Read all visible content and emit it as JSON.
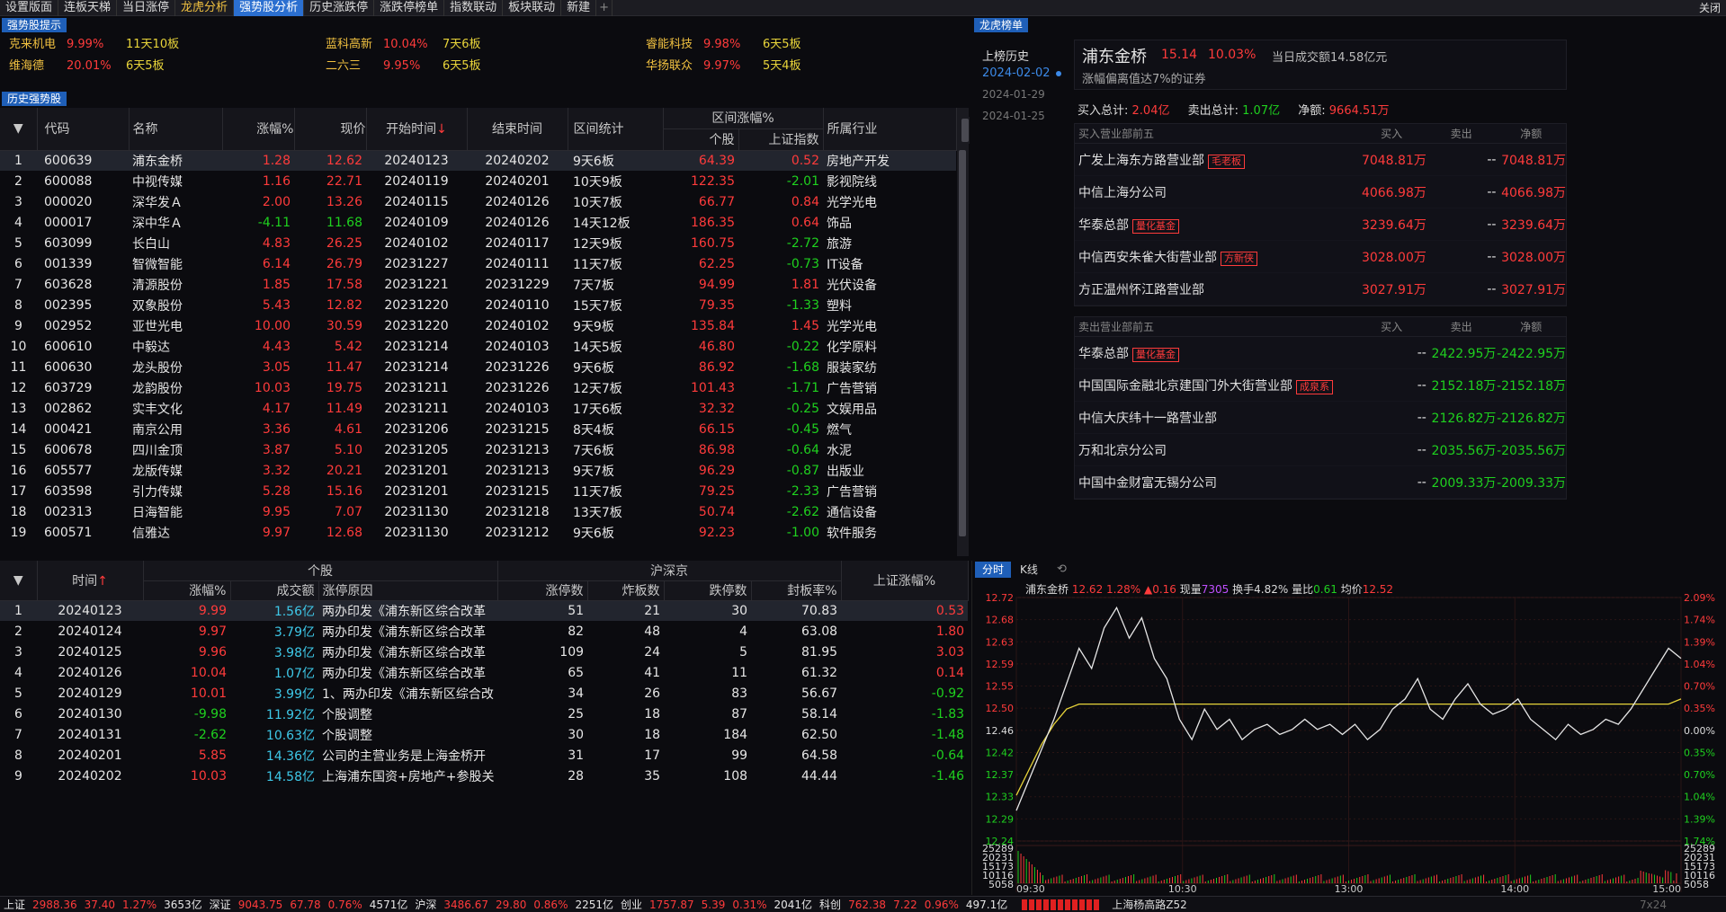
{
  "topbar": {
    "tabs": [
      {
        "label": "设置版面",
        "style": ""
      },
      {
        "label": "连板天梯",
        "style": ""
      },
      {
        "label": "当日涨停",
        "style": ""
      },
      {
        "label": "龙虎分析",
        "style": "hl"
      },
      {
        "label": "强势股分析",
        "style": "active"
      },
      {
        "label": "历史涨跌停",
        "style": ""
      },
      {
        "label": "涨跌停榜单",
        "style": ""
      },
      {
        "label": "指数联动",
        "style": ""
      },
      {
        "label": "板块联动",
        "style": ""
      },
      {
        "label": "新建",
        "style": ""
      }
    ],
    "plus": "+",
    "close": "关闭"
  },
  "hint": {
    "title": "强势股提示",
    "items": [
      {
        "name": "克来机电",
        "pct": "9.99%",
        "board": "11天10板"
      },
      {
        "name": "蓝科高新",
        "pct": "10.04%",
        "board": "7天6板"
      },
      {
        "name": "睿能科技",
        "pct": "9.98%",
        "board": "6天5板"
      },
      {
        "name": "维海德",
        "pct": "20.01%",
        "board": "6天5板"
      },
      {
        "name": "二六三",
        "pct": "9.95%",
        "board": "6天5板"
      },
      {
        "name": "华扬联众",
        "pct": "9.97%",
        "board": "5天4板"
      }
    ]
  },
  "hist": {
    "title": "历史强势股",
    "headers": {
      "code": "代码",
      "name": "名称",
      "pct": "涨幅%",
      "price": "现价",
      "start": "开始时间",
      "end": "结束时间",
      "stat": "区间统计",
      "range": "区间涨幅%",
      "stock": "个股",
      "index": "上证指数",
      "industry": "所属行业",
      "sort_arrow": "↓"
    },
    "rows": [
      [
        "1",
        "600639",
        "浦东金桥",
        "1.28",
        "12.62",
        "20240123",
        "20240202",
        "9天6板",
        "64.39",
        "0.52",
        "房地产开发"
      ],
      [
        "2",
        "600088",
        "中视传媒",
        "1.16",
        "22.71",
        "20240119",
        "20240201",
        "10天9板",
        "122.35",
        "-2.01",
        "影视院线"
      ],
      [
        "3",
        "000020",
        "深华发Ａ",
        "2.00",
        "13.26",
        "20240115",
        "20240126",
        "10天7板",
        "66.77",
        "0.84",
        "光学光电"
      ],
      [
        "4",
        "000017",
        "深中华Ａ",
        "-4.11",
        "11.68",
        "20240109",
        "20240126",
        "14天12板",
        "186.35",
        "0.64",
        "饰品"
      ],
      [
        "5",
        "603099",
        "长白山",
        "4.83",
        "26.25",
        "20240102",
        "20240117",
        "12天9板",
        "160.75",
        "-2.72",
        "旅游"
      ],
      [
        "6",
        "001339",
        "智微智能",
        "6.14",
        "26.79",
        "20231227",
        "20240111",
        "11天7板",
        "62.25",
        "-0.73",
        "IT设备"
      ],
      [
        "7",
        "603628",
        "清源股份",
        "1.85",
        "17.58",
        "20231221",
        "20231229",
        "7天7板",
        "94.99",
        "1.81",
        "光伏设备"
      ],
      [
        "8",
        "002395",
        "双象股份",
        "5.43",
        "12.82",
        "20231220",
        "20240110",
        "15天7板",
        "79.35",
        "-1.33",
        "塑料"
      ],
      [
        "9",
        "002952",
        "亚世光电",
        "10.00",
        "30.59",
        "20231220",
        "20240102",
        "9天9板",
        "135.84",
        "1.45",
        "光学光电"
      ],
      [
        "10",
        "600610",
        "中毅达",
        "4.43",
        "5.42",
        "20231214",
        "20240103",
        "14天5板",
        "46.80",
        "-0.22",
        "化学原料"
      ],
      [
        "11",
        "600630",
        "龙头股份",
        "3.05",
        "11.47",
        "20231214",
        "20231226",
        "9天6板",
        "86.92",
        "-1.68",
        "服装家纺"
      ],
      [
        "12",
        "603729",
        "龙韵股份",
        "10.03",
        "19.75",
        "20231211",
        "20231226",
        "12天7板",
        "101.43",
        "-1.71",
        "广告营销"
      ],
      [
        "13",
        "002862",
        "实丰文化",
        "4.17",
        "11.49",
        "20231211",
        "20240103",
        "17天6板",
        "32.32",
        "-0.25",
        "文娱用品"
      ],
      [
        "14",
        "000421",
        "南京公用",
        "3.36",
        "4.61",
        "20231206",
        "20231215",
        "8天4板",
        "66.15",
        "-0.45",
        "燃气"
      ],
      [
        "15",
        "600678",
        "四川金顶",
        "3.87",
        "5.10",
        "20231205",
        "20231213",
        "7天6板",
        "86.98",
        "-0.64",
        "水泥"
      ],
      [
        "16",
        "605577",
        "龙版传媒",
        "3.32",
        "20.21",
        "20231201",
        "20231213",
        "9天7板",
        "96.29",
        "-0.87",
        "出版业"
      ],
      [
        "17",
        "603598",
        "引力传媒",
        "5.28",
        "15.16",
        "20231201",
        "20231215",
        "11天7板",
        "79.25",
        "-2.33",
        "广告营销"
      ],
      [
        "18",
        "002313",
        "日海智能",
        "9.95",
        "7.07",
        "20231130",
        "20231218",
        "13天7板",
        "50.74",
        "-2.62",
        "通信设备"
      ],
      [
        "19",
        "600571",
        "信雅达",
        "9.97",
        "12.68",
        "20231130",
        "20231212",
        "9天6板",
        "92.23",
        "-1.00",
        "软件服务"
      ]
    ]
  },
  "lower": {
    "headers": {
      "time": "时间",
      "stock_group": "个股",
      "pct": "涨幅%",
      "amount": "成交额",
      "reason": "涨停原因",
      "market_group": "沪深京",
      "zt": "涨停数",
      "zb": "炸板数",
      "dt": "跌停数",
      "fbl": "封板率%",
      "index": "上证涨幅%"
    },
    "rows": [
      [
        "1",
        "20240123",
        "9.99",
        "1.56亿",
        "两办印发《浦东新区综合改革",
        "51",
        "21",
        "30",
        "70.83",
        "0.53"
      ],
      [
        "2",
        "20240124",
        "9.97",
        "3.79亿",
        "两办印发《浦东新区综合改革",
        "82",
        "48",
        "4",
        "63.08",
        "1.80"
      ],
      [
        "3",
        "20240125",
        "9.96",
        "3.98亿",
        "两办印发《浦东新区综合改革",
        "109",
        "24",
        "5",
        "81.95",
        "3.03"
      ],
      [
        "4",
        "20240126",
        "10.04",
        "1.07亿",
        "两办印发《浦东新区综合改革",
        "65",
        "41",
        "11",
        "61.32",
        "0.14"
      ],
      [
        "5",
        "20240129",
        "10.01",
        "3.99亿",
        "1、两办印发《浦东新区综合改",
        "34",
        "26",
        "83",
        "56.67",
        "-0.92"
      ],
      [
        "6",
        "20240130",
        "-9.98",
        "11.92亿",
        "个股调整",
        "25",
        "18",
        "87",
        "58.14",
        "-1.83"
      ],
      [
        "7",
        "20240131",
        "-2.62",
        "10.63亿",
        "个股调整",
        "30",
        "18",
        "184",
        "62.50",
        "-1.48"
      ],
      [
        "8",
        "20240201",
        "5.85",
        "14.36亿",
        "公司的主营业务是上海金桥开",
        "31",
        "17",
        "99",
        "64.58",
        "-0.64"
      ],
      [
        "9",
        "20240202",
        "10.03",
        "14.58亿",
        "上海浦东国资+房地产+参股关",
        "28",
        "35",
        "108",
        "44.44",
        "-1.46"
      ]
    ]
  },
  "lhb": {
    "title": "龙虎榜单",
    "history_label": "上榜历史",
    "dates": [
      "2024-02-02",
      "2024-01-29",
      "2024-01-25"
    ],
    "stock_name": "浦东金桥",
    "price": "15.14",
    "pct": "10.03%",
    "turnover": "当日成交额14.58亿元",
    "reason": "涨幅偏离值达7%的证券",
    "buy_total_label": "买入总计:",
    "buy_total": "2.04亿",
    "sell_total_label": "卖出总计:",
    "sell_total": "1.07亿",
    "net_label": "净额:",
    "net": "9664.51万",
    "buy_header": {
      "title": "买入营业部前五",
      "buy": "买入",
      "sell": "卖出",
      "net": "净额"
    },
    "buy_rows": [
      {
        "name": "广发上海东方路营业部",
        "tag": "毛老板",
        "buy": "7048.81万",
        "sell": "--",
        "net": "7048.81万"
      },
      {
        "name": "中信上海分公司",
        "tag": "",
        "buy": "4066.98万",
        "sell": "--",
        "net": "4066.98万"
      },
      {
        "name": "华泰总部",
        "tag": "量化基金",
        "buy": "3239.64万",
        "sell": "--",
        "net": "3239.64万"
      },
      {
        "name": "中信西安朱雀大街营业部",
        "tag": "方新侠",
        "buy": "3028.00万",
        "sell": "--",
        "net": "3028.00万"
      },
      {
        "name": "方正温州怀江路营业部",
        "tag": "",
        "buy": "3027.91万",
        "sell": "--",
        "net": "3027.91万"
      }
    ],
    "sell_header": {
      "title": "卖出营业部前五",
      "buy": "买入",
      "sell": "卖出",
      "net": "净额"
    },
    "sell_rows": [
      {
        "name": "华泰总部",
        "tag": "量化基金",
        "buy": "--",
        "sell": "2422.95万",
        "net": "-2422.95万"
      },
      {
        "name": "中国国际金融北京建国门外大街营业部",
        "tag": "成泉系",
        "buy": "--",
        "sell": "2152.18万",
        "net": "-2152.18万"
      },
      {
        "name": "中信大庆纬十一路营业部",
        "tag": "",
        "buy": "--",
        "sell": "2126.82万",
        "net": "-2126.82万"
      },
      {
        "name": "万和北京分公司",
        "tag": "",
        "buy": "--",
        "sell": "2035.56万",
        "net": "-2035.56万"
      },
      {
        "name": "中国中金财富无锡分公司",
        "tag": "",
        "buy": "--",
        "sell": "2009.33万",
        "net": "-2009.33万"
      }
    ]
  },
  "chart": {
    "tab_fs": "分时",
    "tab_k": "K线",
    "name": "浦东金桥",
    "price": "12.62",
    "pct": "1.28%",
    "chg": "▲0.16",
    "vol_label": "现量",
    "vol": "7305",
    "turn_label": "换手",
    "turn": "4.82%",
    "ratio_label": "量比",
    "ratio": "0.61",
    "avg_label": "均价",
    "avg": "12.52",
    "left_axis": [
      "12.72",
      "12.68",
      "12.63",
      "12.59",
      "12.55",
      "12.50",
      "12.46",
      "12.42",
      "12.37",
      "12.33",
      "12.29",
      "12.24"
    ],
    "right_axis": [
      "2.09%",
      "1.74%",
      "1.39%",
      "1.04%",
      "0.70%",
      "0.35%",
      "0.00%",
      "0.35%",
      "0.70%",
      "1.04%",
      "1.39%",
      "1.74%"
    ],
    "vol_axis": [
      "25289",
      "20231",
      "15173",
      "10116",
      "5058"
    ],
    "time_axis": [
      "09:30",
      "10:30",
      "13:00",
      "14:00",
      "15:00"
    ],
    "prev_close": 12.46,
    "price_series": [
      12.3,
      12.36,
      12.42,
      12.48,
      12.55,
      12.62,
      12.58,
      12.66,
      12.7,
      12.64,
      12.68,
      12.6,
      12.56,
      12.48,
      12.44,
      12.5,
      12.46,
      12.48,
      12.44,
      12.46,
      12.47,
      12.45,
      12.46,
      12.48,
      12.46,
      12.47,
      12.45,
      12.47,
      12.44,
      12.46,
      12.5,
      12.52,
      12.56,
      12.5,
      12.48,
      12.52,
      12.55,
      12.51,
      12.49,
      12.5,
      12.52,
      12.48,
      12.46,
      12.44,
      12.47,
      12.45,
      12.46,
      12.48,
      12.47,
      12.5,
      12.54,
      12.58,
      12.62,
      12.6
    ],
    "avg_series": [
      12.33,
      12.38,
      12.43,
      12.47,
      12.5,
      12.51,
      12.51,
      12.51,
      12.51,
      12.51,
      12.51,
      12.51,
      12.51,
      12.51,
      12.51,
      12.51,
      12.51,
      12.51,
      12.51,
      12.51,
      12.51,
      12.51,
      12.51,
      12.51,
      12.51,
      12.51,
      12.51,
      12.51,
      12.51,
      12.51,
      12.51,
      12.51,
      12.51,
      12.51,
      12.51,
      12.51,
      12.51,
      12.51,
      12.51,
      12.51,
      12.51,
      12.51,
      12.51,
      12.51,
      12.51,
      12.51,
      12.51,
      12.51,
      12.51,
      12.51,
      12.51,
      12.51,
      12.51,
      12.52
    ]
  },
  "status": {
    "items": [
      {
        "t": "上证",
        "c": "white"
      },
      {
        "t": "2988.36",
        "c": "red"
      },
      {
        "t": "37.40",
        "c": "red"
      },
      {
        "t": "1.27%",
        "c": "red"
      },
      {
        "t": "3653亿",
        "c": "white"
      },
      {
        "t": "深证",
        "c": "white"
      },
      {
        "t": "9043.75",
        "c": "red"
      },
      {
        "t": "67.78",
        "c": "red"
      },
      {
        "t": "0.76%",
        "c": "red"
      },
      {
        "t": "4571亿",
        "c": "white"
      },
      {
        "t": "沪深",
        "c": "white"
      },
      {
        "t": "3486.67",
        "c": "red"
      },
      {
        "t": "29.80",
        "c": "red"
      },
      {
        "t": "0.86%",
        "c": "red"
      },
      {
        "t": "2251亿",
        "c": "white"
      },
      {
        "t": "创业",
        "c": "white"
      },
      {
        "t": "1757.87",
        "c": "red"
      },
      {
        "t": "5.39",
        "c": "red"
      },
      {
        "t": "0.31%",
        "c": "red"
      },
      {
        "t": "2041亿",
        "c": "white"
      },
      {
        "t": "科创",
        "c": "white"
      },
      {
        "t": "762.38",
        "c": "red"
      },
      {
        "t": "7.22",
        "c": "red"
      },
      {
        "t": "0.96%",
        "c": "red"
      },
      {
        "t": "497.1亿",
        "c": "white"
      }
    ],
    "location": "上海杨高路Z52",
    "clock": "7x24"
  }
}
